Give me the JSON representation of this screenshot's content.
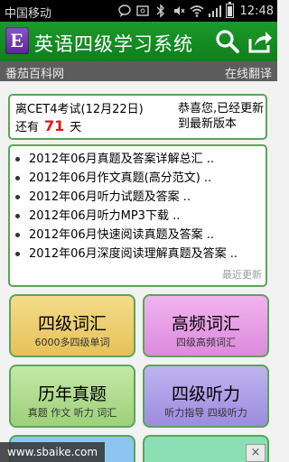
{
  "status_bar": {
    "carrier": "中国移动",
    "time": "12:48"
  },
  "header": {
    "logo_letter": "E",
    "title": "英语四级学习系统",
    "icons": [
      "search-icon",
      "share-icon"
    ],
    "accent_color": "#1c9a2b"
  },
  "subheader": {
    "site_name": "番茄百科网",
    "translate_link": "在线翻译"
  },
  "exam_card": {
    "exam_label": "离CET4考试(12月22日)",
    "days_prefix": "还有",
    "days": "71",
    "days_suffix": "天",
    "update_message": "恭喜您,已经更新到最新版本"
  },
  "news": {
    "items": [
      "2012年06月真题及答案详解总汇 ..",
      "2012年06月作文真题(高分范文) ..",
      "2012年06月听力试题及答案 ..",
      "2012年06月听力MP3下载 ..",
      "2012年06月快速阅读真题及答案 ..",
      "2012年06月深度阅读理解真题及答案 .."
    ],
    "recent_label": "最近更新"
  },
  "tiles": [
    {
      "title": "四级词汇",
      "subtitle": "6000多四级单词"
    },
    {
      "title": "高频词汇",
      "subtitle": "四级高频词汇"
    },
    {
      "title": "历年真题",
      "subtitle": "真题 作文 听力 词汇"
    },
    {
      "title": "四级听力",
      "subtitle": "听力指导 四级听力"
    }
  ],
  "footer": {
    "url": "www.sbaike.com",
    "close_label": "×"
  }
}
